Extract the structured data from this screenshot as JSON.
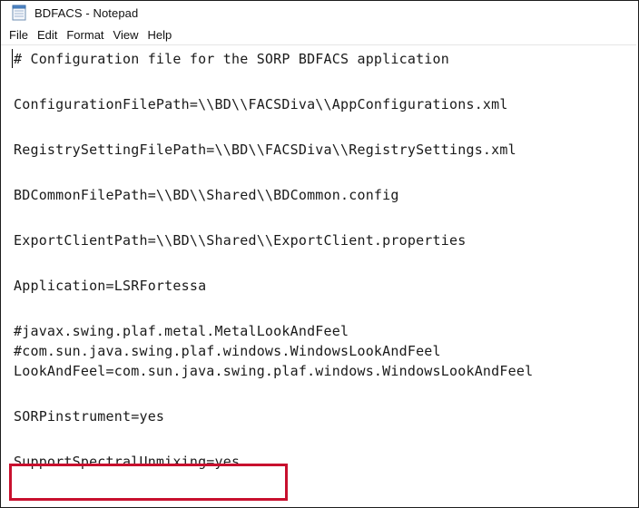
{
  "window": {
    "title": "BDFACS - Notepad"
  },
  "menu": {
    "items": [
      "File",
      "Edit",
      "Format",
      "View",
      "Help"
    ]
  },
  "editor": {
    "lines": [
      "# Configuration file for the SORP BDFACS application",
      "ConfigurationFilePath=\\\\BD\\\\FACSDiva\\\\AppConfigurations.xml",
      "RegistrySettingFilePath=\\\\BD\\\\FACSDiva\\\\RegistrySettings.xml",
      "BDCommonFilePath=\\\\BD\\\\Shared\\\\BDCommon.config",
      "ExportClientPath=\\\\BD\\\\Shared\\\\ExportClient.properties",
      "Application=LSRFortessa",
      "#javax.swing.plaf.metal.MetalLookAndFeel",
      "#com.sun.java.swing.plaf.windows.WindowsLookAndFeel",
      "LookAndFeel=com.sun.java.swing.plaf.windows.WindowsLookAndFeel",
      "SORPinstrument=yes",
      "SupportSpectralUnmixing=yes"
    ]
  },
  "colors": {
    "highlight_border": "#c8102e"
  },
  "icons": {
    "app": "notepad-icon"
  }
}
